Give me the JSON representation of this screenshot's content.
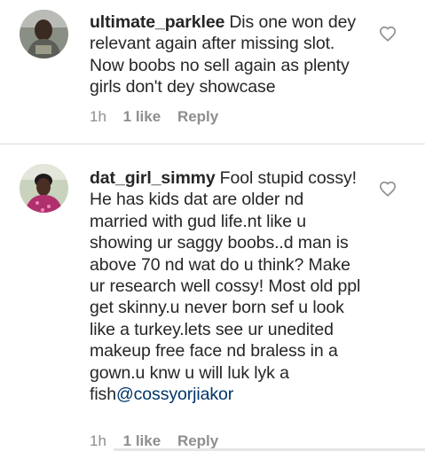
{
  "comments": [
    {
      "username": "ultimate_parklee",
      "text": "Dis one won dey relevant again after missing slot. Now boobs no sell again as plenty girls don't dey showcase",
      "mention": "",
      "time": "1h",
      "likes": "1 like",
      "reply": "Reply"
    },
    {
      "username": "dat_girl_simmy",
      "text": "Fool stupid cossy! He has kids dat are older nd married with gud life.nt like u showing ur saggy boobs..d man is above 70 nd wat do u think? Make ur research well cossy! Most old ppl get skinny.u never born sef u look like a turkey.lets see ur unedited makeup free face nd braless in a gown.u knw u will luk lyk  a fish",
      "mention": "@cossyorjiakor",
      "time": "1h",
      "likes": "1 like",
      "reply": "Reply"
    }
  ],
  "icons": {
    "like": "heart-outline-icon",
    "avatar": "avatar"
  },
  "colors": {
    "text": "#262626",
    "meta": "#8e8e8e",
    "mention": "#003569",
    "divider": "#dbdbdb"
  }
}
